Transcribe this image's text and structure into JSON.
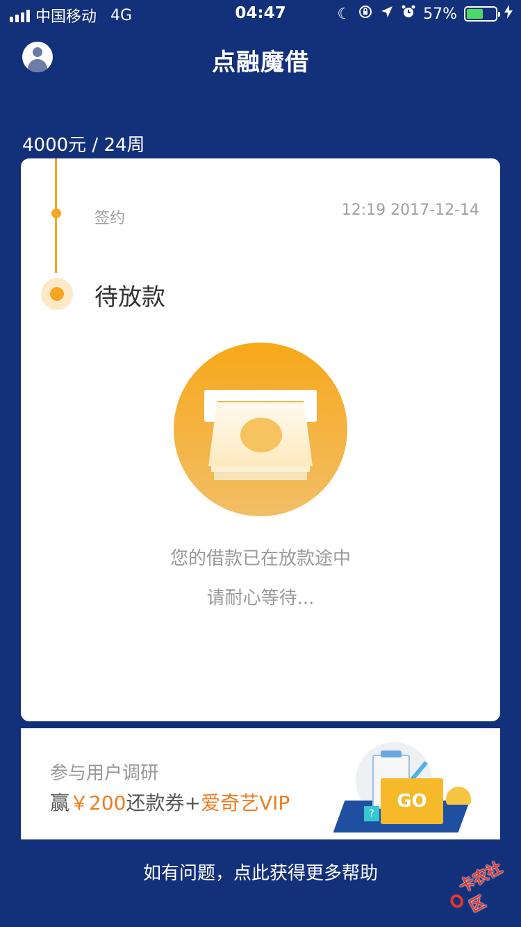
{
  "status_bar": {
    "carrier": "中国移动",
    "network": "4G",
    "time": "04:47",
    "battery_percent": "57%",
    "battery_level": 0.57,
    "icons": [
      "signal-icon",
      "moon-icon",
      "rotation-lock-icon",
      "location-icon",
      "alarm-icon",
      "battery-icon",
      "charging-icon"
    ]
  },
  "header": {
    "title": "点融魔借",
    "avatar_icon": "user-avatar-icon"
  },
  "loan": {
    "summary": "4000元 / 24周"
  },
  "timeline": {
    "steps": [
      {
        "label": "签约",
        "time": "12:19 2017-12-14"
      },
      {
        "label": "待放款"
      }
    ]
  },
  "status_card": {
    "illustration": "cash-dispense-icon",
    "message_line1": "您的借款已在放款途中",
    "message_line2": "请耐心等待..."
  },
  "banner": {
    "line1": "参与用户调研",
    "line2_prefix": "赢",
    "line2_amount": "￥200",
    "line2_mid": "还款券+",
    "line2_vip": "爱奇艺VIP",
    "go_label": "GO",
    "cube_label": "?"
  },
  "footer": {
    "help_text": "如有问题，点此获得更多帮助"
  },
  "watermark": {
    "text": "卡农社区"
  },
  "colors": {
    "background": "#13307a",
    "accent": "#f5a623",
    "highlight": "#f07c1e",
    "card": "#ffffff"
  }
}
